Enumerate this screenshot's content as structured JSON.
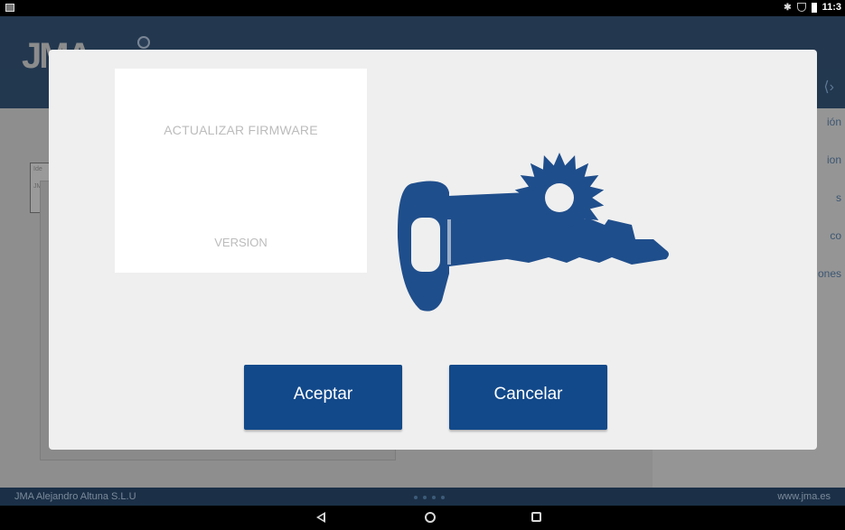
{
  "status_bar": {
    "time": "11:3"
  },
  "app": {
    "logo_text": "JMA",
    "side_menu": [
      "ión",
      "ion",
      "s",
      "co",
      "ones"
    ],
    "bg_field_lines": [
      "Ide",
      "JMA"
    ]
  },
  "dialog": {
    "info_title": "ACTUALIZAR FIRMWARE",
    "info_version": "VERSION",
    "accept_label": "Aceptar",
    "cancel_label": "Cancelar",
    "icon": "key-cutter-icon",
    "accent_color": "#12498a"
  },
  "footer": {
    "left_text": "JMA Alejandro Altuna S.L.U",
    "right_text": "www.jma.es"
  },
  "nav_bar": {
    "buttons": [
      "back-icon",
      "home-icon",
      "recents-icon"
    ]
  }
}
